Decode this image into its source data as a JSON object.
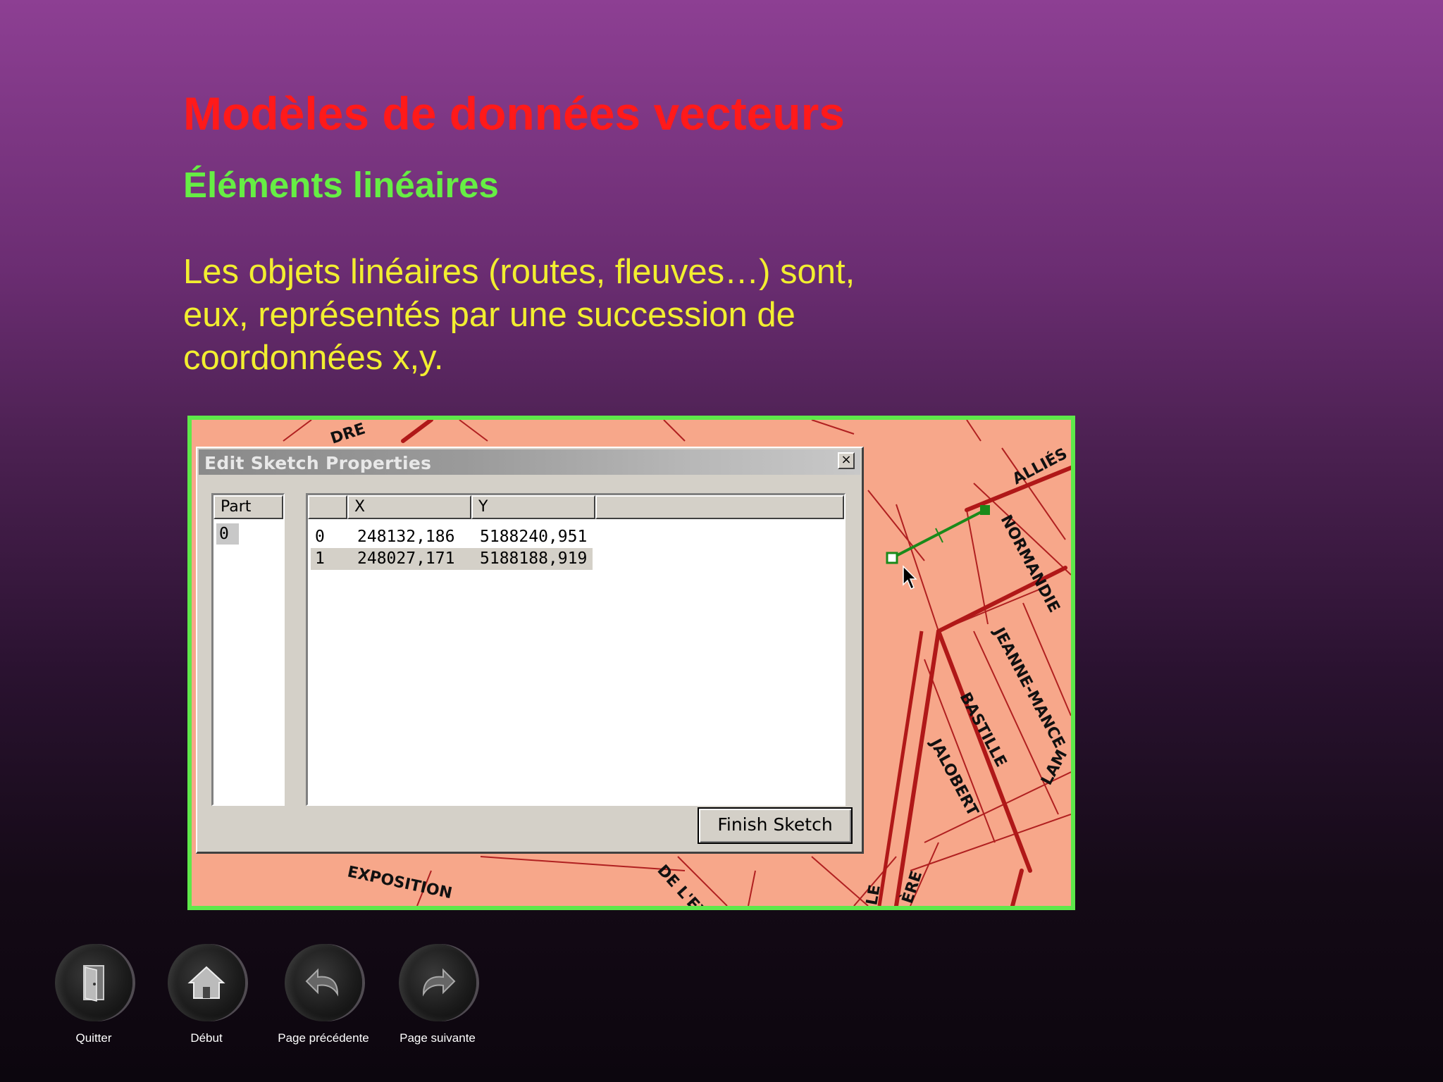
{
  "slide": {
    "title": "Modèles de données vecteurs",
    "subtitle": "Éléments linéaires",
    "body_lines": [
      "Les objets linéaires (routes, fleuves…) sont,",
      "eux, représentés par une succession de",
      "coordonnées x,y."
    ]
  },
  "map": {
    "street_labels": [
      "ALLIÉS",
      "NORMANDIE",
      "JEANNE-MANCE",
      "BASTILLE",
      "JALOBERT",
      "LAM",
      "EXPOSITION",
      "DE L'EXP",
      "ÈRE",
      "DRE",
      "LE"
    ]
  },
  "dialog": {
    "title": "Edit Sketch Properties",
    "close_glyph": "×",
    "part_header": "Part",
    "parts": [
      "0"
    ],
    "columns": [
      "",
      "X",
      "Y",
      ""
    ],
    "vertices": [
      {
        "index": "0",
        "x": "248132,186",
        "y": "5188240,951"
      },
      {
        "index": "1",
        "x": "248027,171",
        "y": "5188188,919"
      }
    ],
    "finish_label": "Finish Sketch"
  },
  "nav": [
    {
      "label": "Quitter",
      "icon": "door-icon"
    },
    {
      "label": "Début",
      "icon": "home-icon"
    },
    {
      "label": "Page précédente",
      "icon": "back-arrow-icon"
    },
    {
      "label": "Page suivante",
      "icon": "forward-arrow-icon"
    }
  ],
  "colors": {
    "title": "#ff1a1a",
    "subtitle": "#66ee44",
    "body": "#f2ee30",
    "map_bg": "#f7a78a",
    "frame": "#5ee84a",
    "sketch_line": "#1a8a1a",
    "road": "#b01818"
  }
}
